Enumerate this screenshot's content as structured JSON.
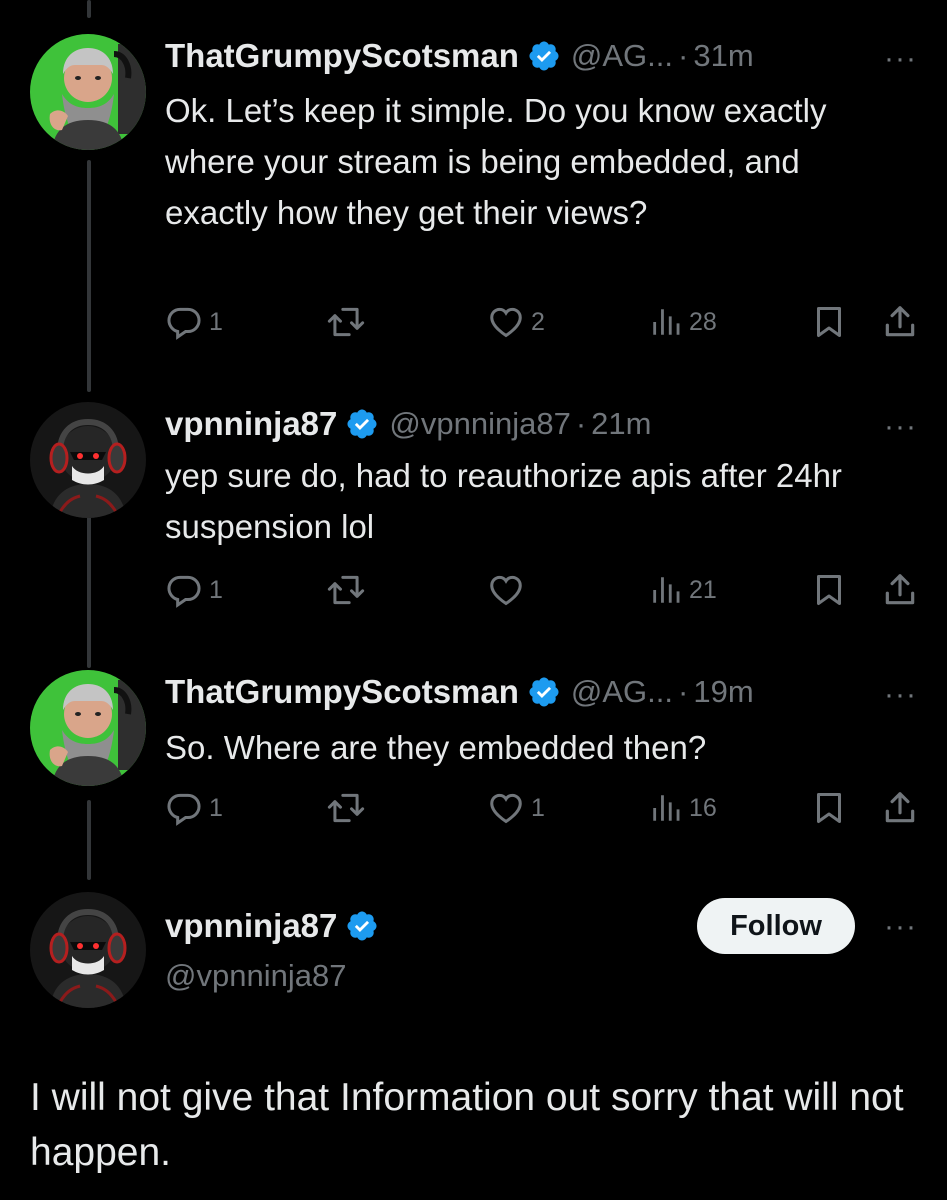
{
  "tweets": [
    {
      "name": "ThatGrumpyScotsman",
      "handle": "@AG...",
      "separator": "·",
      "time": "31m",
      "text": "Ok. Let’s keep it simple. Do you know exactly where your stream is being embedded, and exactly how they get their views?",
      "replies": "1",
      "likes": "2",
      "views": "28",
      "avatar_theme": "green-bearded-man"
    },
    {
      "name": "vpnninja87",
      "handle": "@vpnninja87",
      "separator": "·",
      "time": "21m",
      "text": "yep sure do, had to reauthorize apis after 24hr suspension lol",
      "replies": "1",
      "likes": "",
      "views": "21",
      "avatar_theme": "dark-ninja-headset"
    },
    {
      "name": "ThatGrumpyScotsman",
      "handle": "@AG...",
      "separator": "·",
      "time": "19m",
      "text": "So. Where are they embedded then?",
      "replies": "1",
      "likes": "1",
      "views": "16",
      "avatar_theme": "green-bearded-man"
    }
  ],
  "main_tweet": {
    "name": "vpnninja87",
    "handle": "@vpnninja87",
    "follow_label": "Follow",
    "text": "I will not give that Information out sorry that will not happen.",
    "avatar_theme": "dark-ninja-headset"
  },
  "more_icon": "···",
  "colors": {
    "background": "#000000",
    "text": "#e7e9ea",
    "secondary": "#71767b",
    "verified": "#1d9bf0",
    "thread_line": "#333639",
    "follow_bg": "#eff3f4"
  },
  "icons": [
    "reply-icon",
    "retweet-icon",
    "like-icon",
    "views-icon",
    "bookmark-icon",
    "share-icon",
    "verified-badge-icon",
    "more-icon"
  ]
}
